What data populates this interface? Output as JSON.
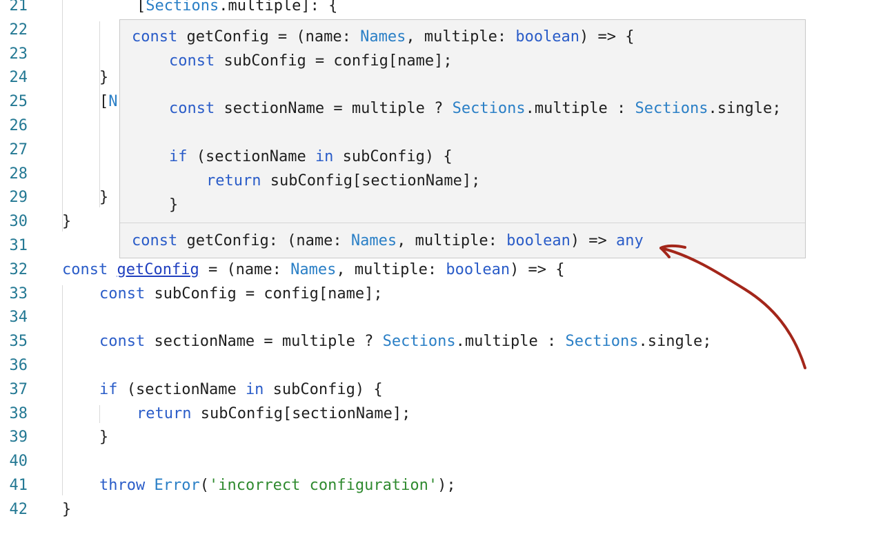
{
  "editor": {
    "lines": [
      {
        "num": "21",
        "indent": 2,
        "tokens": [
          {
            "t": "[",
            "c": "tok"
          },
          {
            "t": "Sections",
            "c": "ty"
          },
          {
            "t": ".multiple]: {",
            "c": "tok"
          }
        ]
      },
      {
        "num": "22",
        "indent": 0,
        "tokens": []
      },
      {
        "num": "23",
        "indent": 0,
        "tokens": []
      },
      {
        "num": "24",
        "indent": 1,
        "tokens": [
          {
            "t": "}",
            "c": "tok"
          }
        ]
      },
      {
        "num": "25",
        "indent": 1,
        "tokens": [
          {
            "t": "[",
            "c": "tok"
          },
          {
            "t": "N",
            "c": "ty"
          }
        ]
      },
      {
        "num": "26",
        "indent": 0,
        "tokens": []
      },
      {
        "num": "27",
        "indent": 0,
        "tokens": []
      },
      {
        "num": "28",
        "indent": 0,
        "tokens": []
      },
      {
        "num": "29",
        "indent": 1,
        "tokens": [
          {
            "t": "}",
            "c": "tok"
          }
        ]
      },
      {
        "num": "30",
        "indent": 0,
        "tokens": [
          {
            "t": "}",
            "c": "tok"
          }
        ]
      },
      {
        "num": "31",
        "indent": 0,
        "tokens": []
      },
      {
        "num": "32",
        "indent": 0,
        "tokens": [
          {
            "t": "const",
            "c": "kw"
          },
          {
            "t": " ",
            "c": "tok"
          },
          {
            "t": "getConfig",
            "c": "fn-link"
          },
          {
            "t": " = (name: ",
            "c": "tok"
          },
          {
            "t": "Names",
            "c": "ty"
          },
          {
            "t": ", multiple: ",
            "c": "tok"
          },
          {
            "t": "boolean",
            "c": "kw"
          },
          {
            "t": ") => {",
            "c": "tok"
          }
        ]
      },
      {
        "num": "33",
        "indent": 1,
        "tokens": [
          {
            "t": "const",
            "c": "kw"
          },
          {
            "t": " subConfig = config[name];",
            "c": "tok"
          }
        ]
      },
      {
        "num": "34",
        "indent": 0,
        "tokens": []
      },
      {
        "num": "35",
        "indent": 1,
        "tokens": [
          {
            "t": "const",
            "c": "kw"
          },
          {
            "t": " sectionName = multiple ? ",
            "c": "tok"
          },
          {
            "t": "Sections",
            "c": "ty"
          },
          {
            "t": ".multiple : ",
            "c": "tok"
          },
          {
            "t": "Sections",
            "c": "ty"
          },
          {
            "t": ".single;",
            "c": "tok"
          }
        ]
      },
      {
        "num": "36",
        "indent": 0,
        "tokens": []
      },
      {
        "num": "37",
        "indent": 1,
        "tokens": [
          {
            "t": "if",
            "c": "kw"
          },
          {
            "t": " (sectionName ",
            "c": "tok"
          },
          {
            "t": "in",
            "c": "kw"
          },
          {
            "t": " subConfig) {",
            "c": "tok"
          }
        ]
      },
      {
        "num": "38",
        "indent": 2,
        "tokens": [
          {
            "t": "return",
            "c": "kw"
          },
          {
            "t": " subConfig[sectionName];",
            "c": "tok"
          }
        ]
      },
      {
        "num": "39",
        "indent": 1,
        "tokens": [
          {
            "t": "}",
            "c": "tok"
          }
        ]
      },
      {
        "num": "40",
        "indent": 0,
        "tokens": []
      },
      {
        "num": "41",
        "indent": 1,
        "tokens": [
          {
            "t": "throw",
            "c": "kw"
          },
          {
            "t": " ",
            "c": "tok"
          },
          {
            "t": "Error",
            "c": "ty"
          },
          {
            "t": "(",
            "c": "tok"
          },
          {
            "t": "'incorrect configuration'",
            "c": "str"
          },
          {
            "t": ");",
            "c": "tok"
          }
        ]
      },
      {
        "num": "42",
        "indent": 0,
        "tokens": [
          {
            "t": "}",
            "c": "tok"
          }
        ]
      }
    ]
  },
  "hover": {
    "preview_lines": [
      {
        "indent": 0,
        "tokens": [
          {
            "t": "const",
            "c": "kw"
          },
          {
            "t": " getConfig = (name: ",
            "c": "tok"
          },
          {
            "t": "Names",
            "c": "ty"
          },
          {
            "t": ", multiple: ",
            "c": "tok"
          },
          {
            "t": "boolean",
            "c": "kw"
          },
          {
            "t": ") => {",
            "c": "tok"
          }
        ]
      },
      {
        "indent": 1,
        "tokens": [
          {
            "t": "const",
            "c": "kw"
          },
          {
            "t": " subConfig = config[name];",
            "c": "tok"
          }
        ]
      },
      {
        "indent": 0,
        "tokens": []
      },
      {
        "indent": 1,
        "tokens": [
          {
            "t": "const",
            "c": "kw"
          },
          {
            "t": " sectionName = multiple ? ",
            "c": "tok"
          },
          {
            "t": "Sections",
            "c": "ty"
          },
          {
            "t": ".multiple : ",
            "c": "tok"
          },
          {
            "t": "Sections",
            "c": "ty"
          },
          {
            "t": ".single;",
            "c": "tok"
          }
        ]
      },
      {
        "indent": 0,
        "tokens": []
      },
      {
        "indent": 1,
        "tokens": [
          {
            "t": "if",
            "c": "kw"
          },
          {
            "t": " (sectionName ",
            "c": "tok"
          },
          {
            "t": "in",
            "c": "kw"
          },
          {
            "t": " subConfig) {",
            "c": "tok"
          }
        ]
      },
      {
        "indent": 2,
        "tokens": [
          {
            "t": "return",
            "c": "kw"
          },
          {
            "t": " subConfig[sectionName];",
            "c": "tok"
          }
        ]
      },
      {
        "indent": 1,
        "tokens": [
          {
            "t": "}",
            "c": "tok"
          }
        ]
      }
    ],
    "signature": [
      {
        "t": "const",
        "c": "kw"
      },
      {
        "t": " getConfig: (name: ",
        "c": "tok"
      },
      {
        "t": "Names",
        "c": "ty"
      },
      {
        "t": ", multiple: ",
        "c": "tok"
      },
      {
        "t": "boolean",
        "c": "kw"
      },
      {
        "t": ") => ",
        "c": "tok"
      },
      {
        "t": "any",
        "c": "kw"
      }
    ]
  },
  "annotation": {
    "icon": "hand-drawn-arrow-icon",
    "color": "#a3261a"
  },
  "colors": {
    "keyword": "#2a5cc8",
    "type": "#2a7fc6",
    "string": "#2f8a2f",
    "line_number": "#237893",
    "hover_background": "#f3f3f3"
  }
}
